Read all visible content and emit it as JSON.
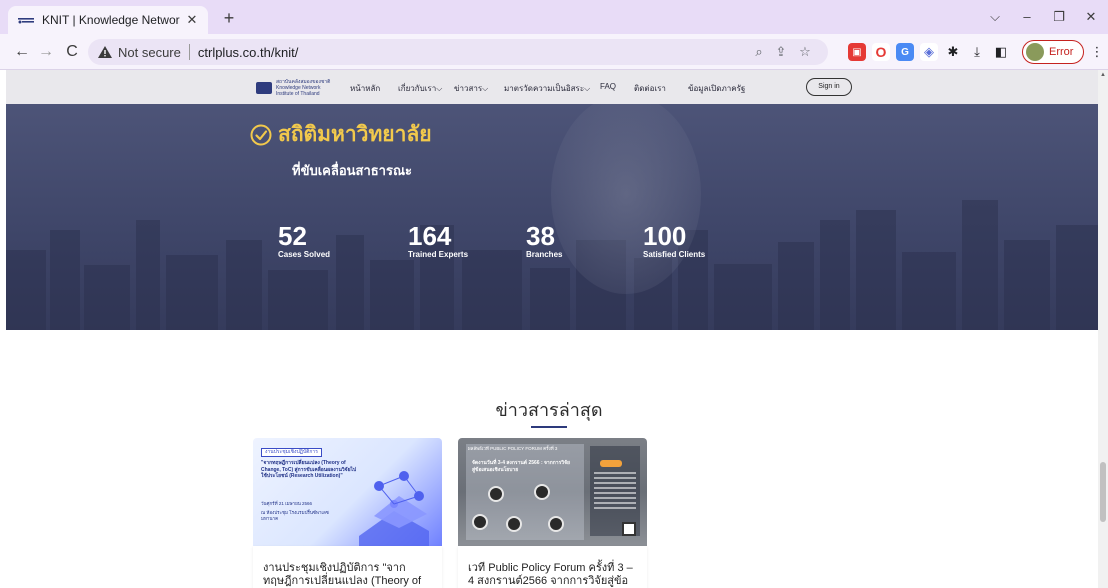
{
  "browser": {
    "tab_title": "KNIT | Knowledge Network Institu",
    "url_security": "Not secure",
    "url": "ctrlplus.co.th/knit/",
    "profile_status": "Error"
  },
  "site_nav": {
    "logo_text": "สถาบันคลังสมองของชาติ Knowledge Network Institute of Thailand",
    "items": [
      {
        "label": "หน้าหลัก"
      },
      {
        "label": "เกี่ยวกับเรา⌵"
      },
      {
        "label": "ข่าวสาร⌵"
      },
      {
        "label": "มาตรวัดความเป็นอิสระ⌵"
      },
      {
        "label": "FAQ"
      },
      {
        "label": "ติดต่อเรา"
      },
      {
        "label": "ข้อมูลเปิดภาครัฐ"
      }
    ],
    "sign_in": "Sign in"
  },
  "hero": {
    "title": "สถิติมหาวิทยาลัย",
    "subtitle": "ที่ขับเคลื่อนสาธารณะ",
    "accent_color": "#f2c94c",
    "stats": [
      {
        "value": "52",
        "label": "Cases Solved"
      },
      {
        "value": "164",
        "label": "Trained Experts"
      },
      {
        "value": "38",
        "label": "Branches"
      },
      {
        "value": "100",
        "label": "Satisfied Clients"
      }
    ]
  },
  "news": {
    "heading": "ข่าวสารล่าสุด",
    "cards": [
      {
        "image_tag": "งานประชุมเชิงปฏิบัติการ",
        "image_text": "\"จากทฤษฎีการเปลี่ยนแปลง (Theory of Change, ToC) สู่การขับเคลื่อนผลงานวิจัยไปใช้ประโยชน์ (Research Utilization)\"",
        "image_date": "วันศุกร์ที่ 21 เมษายน 2566",
        "image_location": "ณ ห้องประชุม โรงแรมปริ้นซ์พาเลซ มหานาค",
        "title": "งานประชุมเชิงปฏิบัติการ \"จากทฤษฎีการเปลี่ยนแปลง (Theory of"
      },
      {
        "image_banner": "ผลลัพธ์เวที PUBLIC POLICY FORUM ครั้งที่ 3",
        "image_headline": "จัดงานวันที่ 3-4 สงกรานต์ 2566 : จากการวิจัยสู่ข้อเสนอเชิงนโยบาย",
        "title": "เวที Public Policy Forum ครั้งที่ 3 – 4 สงกรานต์2566 จากการวิจัยสู่ข้อ"
      }
    ]
  }
}
